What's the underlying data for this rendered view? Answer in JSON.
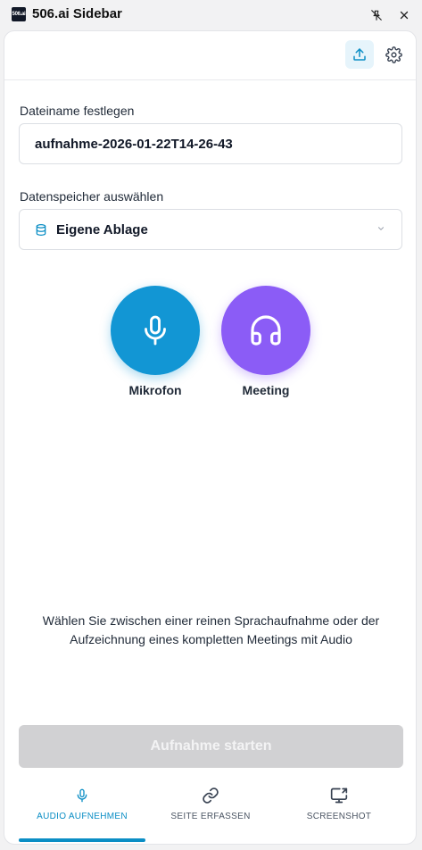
{
  "window": {
    "logo_text": "506.ai",
    "title": "506.ai Sidebar"
  },
  "form": {
    "filename_label": "Dateiname festlegen",
    "filename_value": "aufnahme-2026-01-22T14-26-43",
    "storage_label": "Datenspeicher auswählen",
    "storage_value": "Eigene Ablage"
  },
  "modes": [
    {
      "label": "Mikrofon",
      "icon": "microphone-icon",
      "color": "#1296d4"
    },
    {
      "label": "Meeting",
      "icon": "headphones-icon",
      "color": "#8b5cf6"
    }
  ],
  "description": "Wählen Sie zwischen einer reinen Sprachaufnahme oder der Aufzeichnung eines kompletten Meetings mit Audio",
  "start_button": "Aufnahme starten",
  "nav": [
    {
      "label": "AUDIO AUFNEHMEN",
      "icon": "microphone-icon",
      "active": true
    },
    {
      "label": "SEITE ERFASSEN",
      "icon": "link-icon",
      "active": false
    },
    {
      "label": "SCREENSHOT",
      "icon": "screen-share-icon",
      "active": false
    }
  ],
  "colors": {
    "accent": "#0b8ec5",
    "microphone": "#1296d4",
    "meeting": "#8b5cf6",
    "disabled_button": "#d1d1d3"
  }
}
